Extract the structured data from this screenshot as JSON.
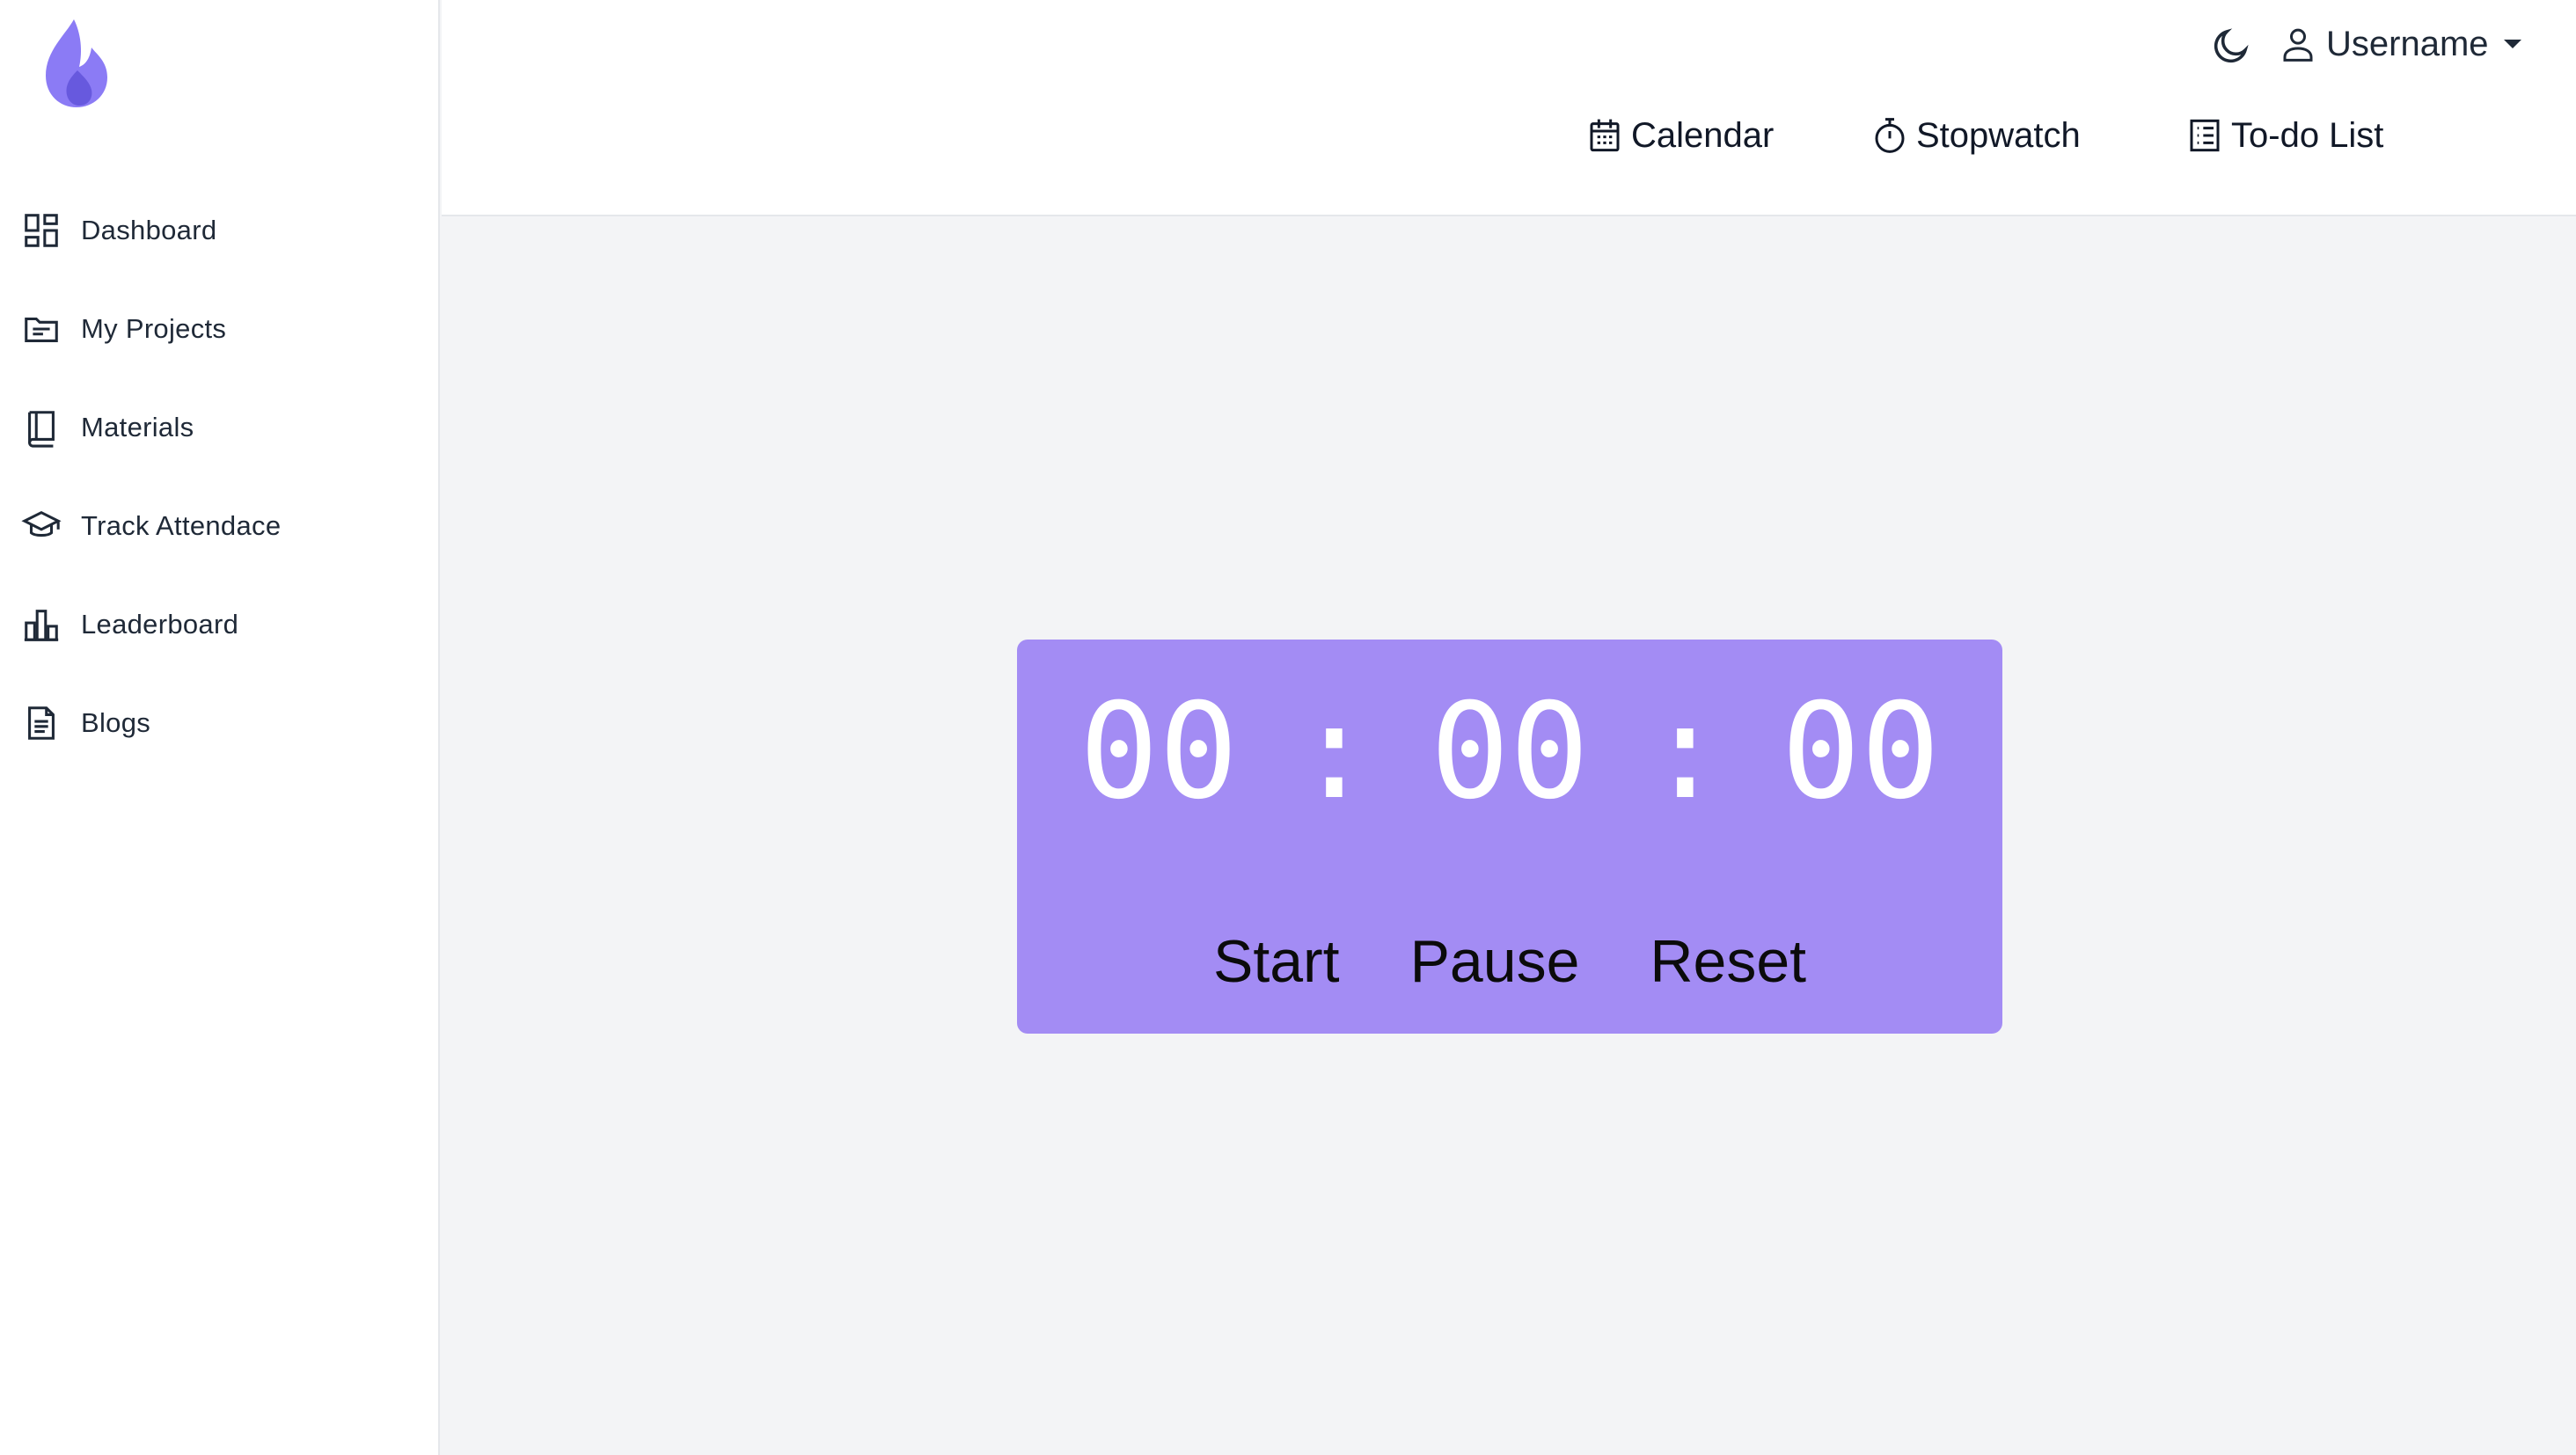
{
  "sidebar": {
    "logo": "flame-logo",
    "items": [
      {
        "label": "Dashboard",
        "icon": "dashboard-icon"
      },
      {
        "label": "My Projects",
        "icon": "folder-icon"
      },
      {
        "label": "Materials",
        "icon": "book-icon"
      },
      {
        "label": "Track Attendace",
        "icon": "graduation-cap-icon"
      },
      {
        "label": "Leaderboard",
        "icon": "bar-chart-icon"
      },
      {
        "label": "Blogs",
        "icon": "document-icon"
      }
    ]
  },
  "header": {
    "theme_toggle": "moon-icon",
    "user": {
      "label": "Username",
      "icon": "user-icon"
    },
    "tools": [
      {
        "label": "Calendar",
        "icon": "calendar-icon"
      },
      {
        "label": "Stopwatch",
        "icon": "stopwatch-icon"
      },
      {
        "label": "To-do List",
        "icon": "list-icon"
      }
    ]
  },
  "stopwatch": {
    "hours": "00",
    "minutes": "00",
    "seconds": "00",
    "separator": ":",
    "start_label": "Start",
    "pause_label": "Pause",
    "reset_label": "Reset"
  },
  "colors": {
    "accent": "#a38cf4",
    "logo": "#7c6cf0",
    "background": "#f3f4f6",
    "sidebar_bg": "#ffffff"
  }
}
